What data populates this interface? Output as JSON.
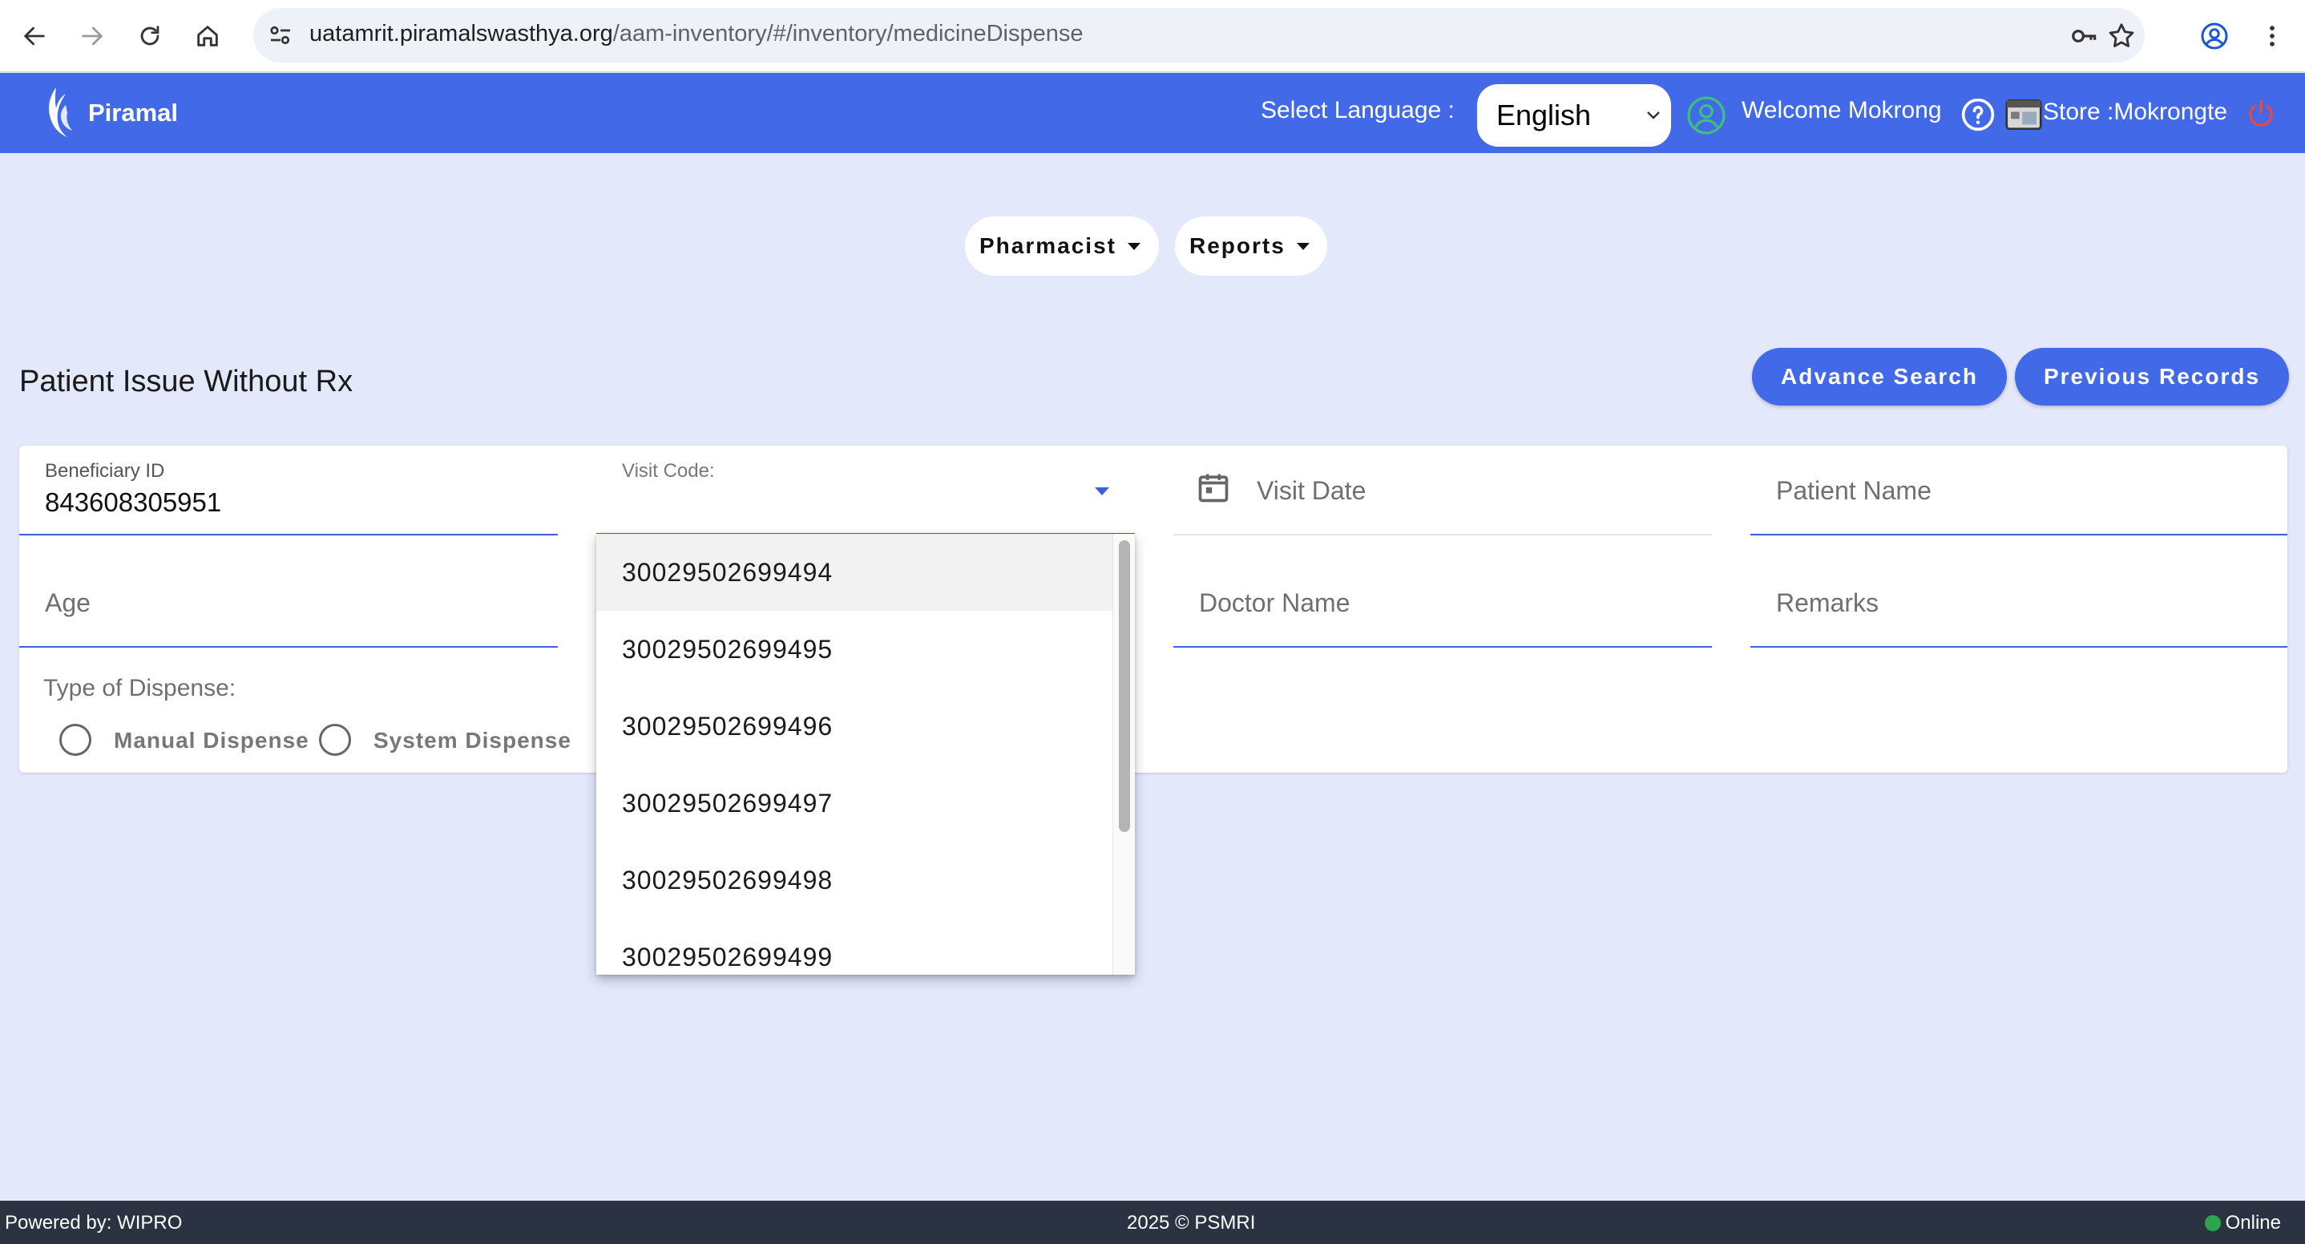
{
  "browser": {
    "url_host": "uatamrit.piramalswasthya.org",
    "url_path": "/aam-inventory/#/inventory/medicineDispense"
  },
  "header": {
    "brand": "Piramal",
    "select_language_label": "Select Language :",
    "language_value": "English",
    "welcome_prefix": "Welcome ",
    "user_name": "Mokrong",
    "store_label": "Store :",
    "store_name": "Mokrongte"
  },
  "menus": {
    "pharmacist": "Pharmacist",
    "reports": "Reports"
  },
  "page": {
    "title": "Patient Issue Without Rx",
    "advance_search": "Advance Search",
    "previous_records": "Previous Records"
  },
  "form": {
    "beneficiary_id_label": "Beneficiary ID",
    "beneficiary_id_value": "843608305951",
    "visit_code_label": "Visit Code:",
    "visit_date_placeholder": "Visit Date",
    "patient_name_placeholder": "Patient Name",
    "age_placeholder": "Age",
    "doctor_name_placeholder": "Doctor Name",
    "remarks_placeholder": "Remarks",
    "dispense_type_label": "Type of Dispense:",
    "manual_dispense": "Manual Dispense",
    "system_dispense": "System Dispense"
  },
  "visit_code_options": [
    "30029502699494",
    "30029502699495",
    "30029502699496",
    "30029502699497",
    "30029502699498",
    "30029502699499"
  ],
  "footer": {
    "powered_by": "Powered by: WIPRO",
    "copyright": "2025 © PSMRI",
    "status": "Online"
  },
  "colors": {
    "header_bg": "#4169e8",
    "page_bg": "#e3e8fb",
    "footer_bg": "#2b3342",
    "online": "#2ea44f"
  }
}
